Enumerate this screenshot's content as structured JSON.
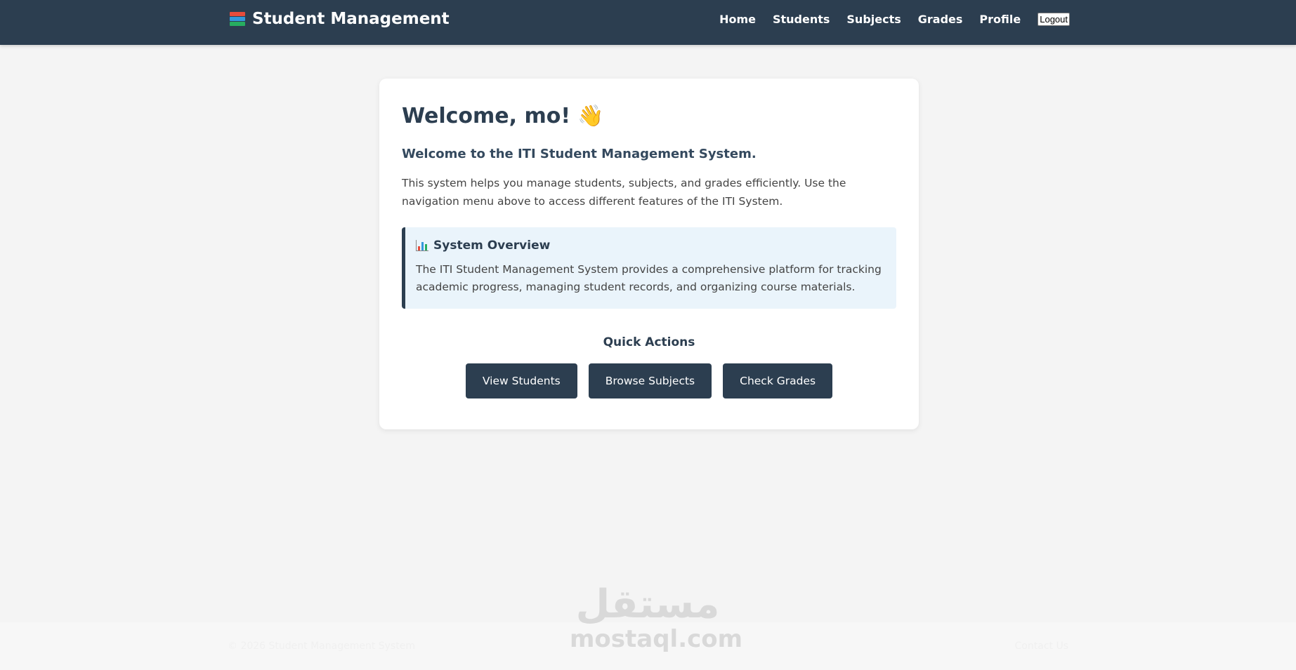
{
  "nav": {
    "brand": "Student Management",
    "brand_icon": "books-icon",
    "links": [
      "Home",
      "Students",
      "Subjects",
      "Grades",
      "Profile"
    ],
    "logout_label": "Logout"
  },
  "main": {
    "welcome_heading": "Welcome, mo!",
    "welcome_icon": "👋",
    "subtitle": "Welcome to the ITI Student Management System.",
    "intro": "This system helps you manage students, subjects, and grades efficiently. Use the navigation menu above to access different features of the ITI System.",
    "overview": {
      "icon": "bar-chart-icon",
      "title": "System Overview",
      "text": "The ITI Student Management System provides a comprehensive platform for tracking academic progress, managing student records, and organizing course materials."
    },
    "quick_actions": {
      "title": "Quick Actions",
      "buttons": [
        "View Students",
        "Browse Subjects",
        "Check Grades"
      ]
    }
  },
  "footer": {
    "copyright": "© 2026 Student Management System",
    "contact": "Contact Us"
  },
  "watermark": {
    "arabic": "مستقل",
    "latin": "mostaql.com"
  },
  "colors": {
    "navbar": "#2c3e50",
    "button": "#2c3e50",
    "overview_bg": "#eaf4fb",
    "page_bg": "#f4f4f4"
  }
}
